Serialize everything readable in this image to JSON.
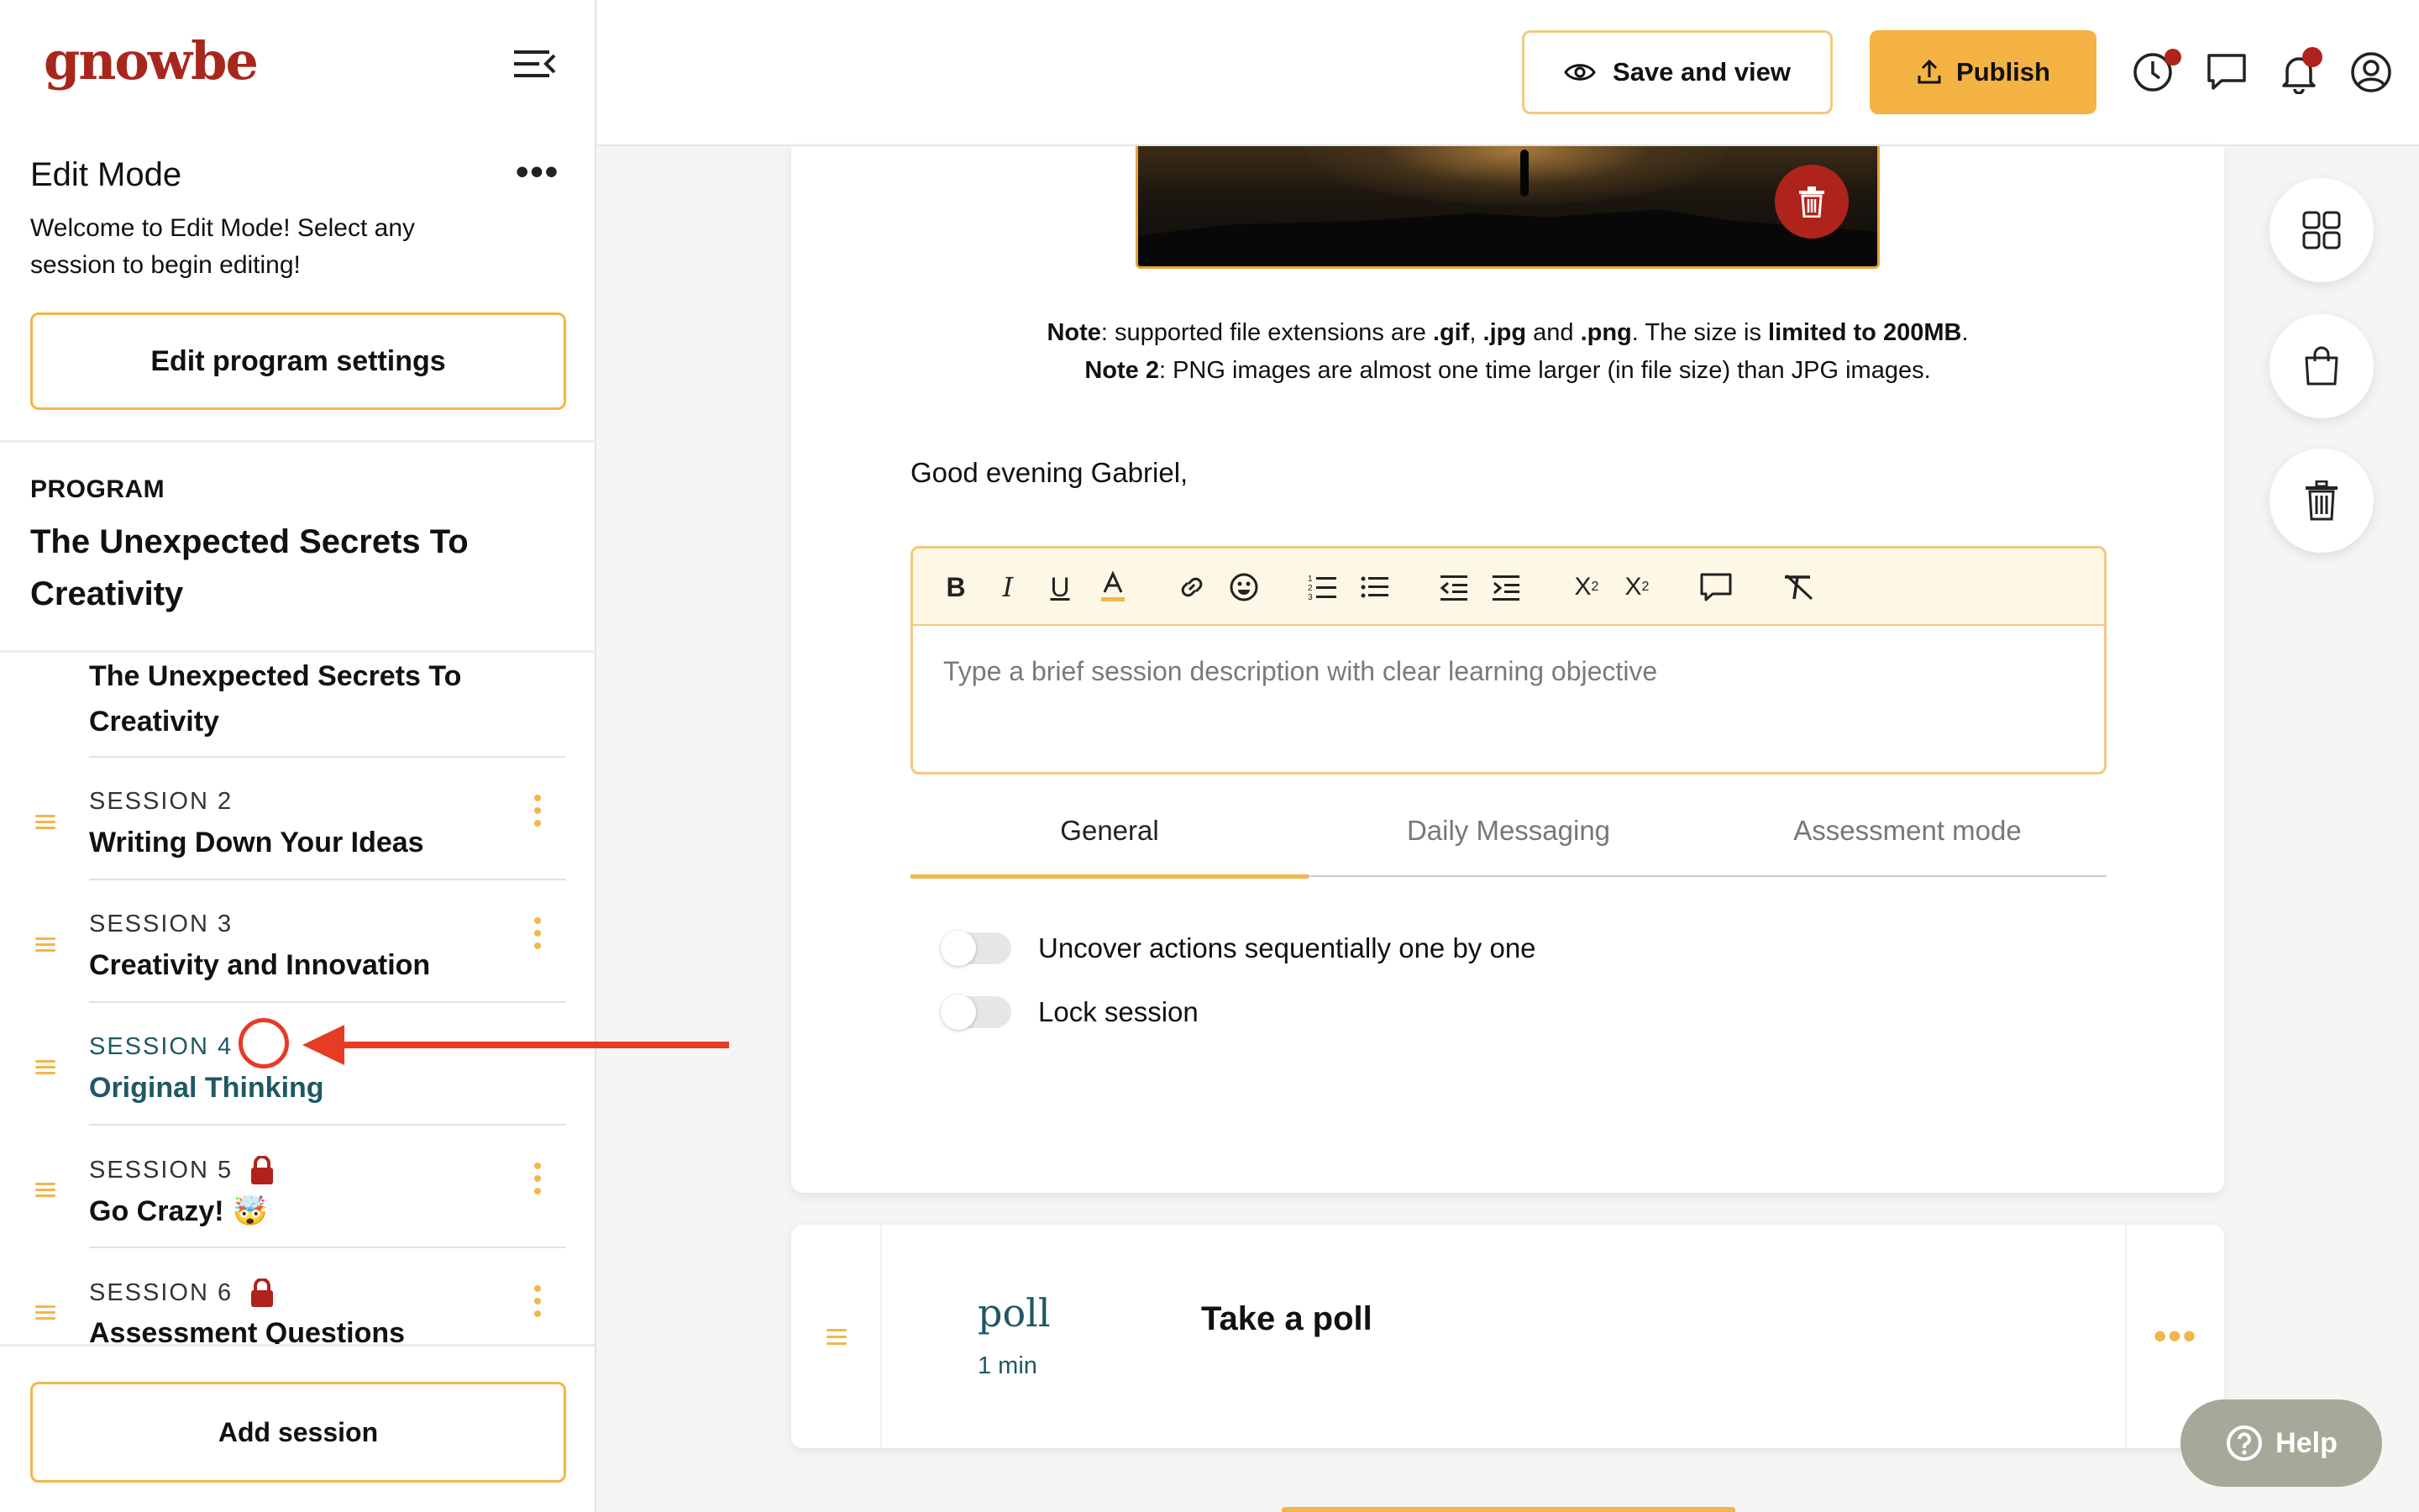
{
  "sidebar": {
    "logo": "gnowbe",
    "edit_mode_title": "Edit Mode",
    "edit_mode_desc": "Welcome to Edit Mode! Select any session to begin editing!",
    "edit_program_btn": "Edit program settings",
    "program_label": "PROGRAM",
    "program_name": "The Unexpected Secrets To Creativity",
    "first_session_title": "The Unexpected Secrets To Creativity",
    "sessions": [
      {
        "number": "SESSION 2",
        "title": "Writing Down Your Ideas",
        "locked": false,
        "active": false
      },
      {
        "number": "SESSION 3",
        "title": "Creativity and Innovation",
        "locked": false,
        "active": false
      },
      {
        "number": "SESSION 4",
        "title": "Original Thinking",
        "locked": false,
        "active": true
      },
      {
        "number": "SESSION 5",
        "title": "Go Crazy!",
        "emoji": "🤯",
        "locked": true,
        "active": false
      },
      {
        "number": "SESSION 6",
        "title": "Assessment Questions",
        "locked": true,
        "active": false
      }
    ],
    "add_session_btn": "Add session"
  },
  "topbar": {
    "save_view_label": "Save and view",
    "publish_label": "Publish",
    "icons": [
      "history-icon",
      "chat-icon",
      "bell-icon",
      "account-icon"
    ]
  },
  "main": {
    "note_line1": {
      "prefix": "Note",
      "text1": ": supported file extensions are ",
      "ext1": ".gif",
      "sep1": ", ",
      "ext2": ".jpg",
      "sep2": " and ",
      "ext3": ".png",
      "text2": ". The size is ",
      "limit": "limited to 200MB",
      "end": "."
    },
    "note_line2": {
      "prefix": "Note 2",
      "text": ": PNG images are almost one time larger (in file size) than JPG images."
    },
    "greeting": "Good evening Gabriel,",
    "editor_placeholder": "Type a brief session description with clear learning objective",
    "tabs": [
      "General",
      "Daily Messaging",
      "Assessment mode"
    ],
    "active_tab": "General",
    "toggles": [
      {
        "label": "Uncover actions sequentially one by one",
        "on": false
      },
      {
        "label": "Lock session",
        "on": false
      }
    ]
  },
  "poll_card": {
    "type_word": "poll",
    "duration": "1 min",
    "title": "Take a poll"
  },
  "help_label": "Help",
  "colors": {
    "brand_red": "#a8271d",
    "accent_orange": "#f2b64b",
    "active_teal": "#1e5962",
    "annotation_red": "#e63b25"
  }
}
